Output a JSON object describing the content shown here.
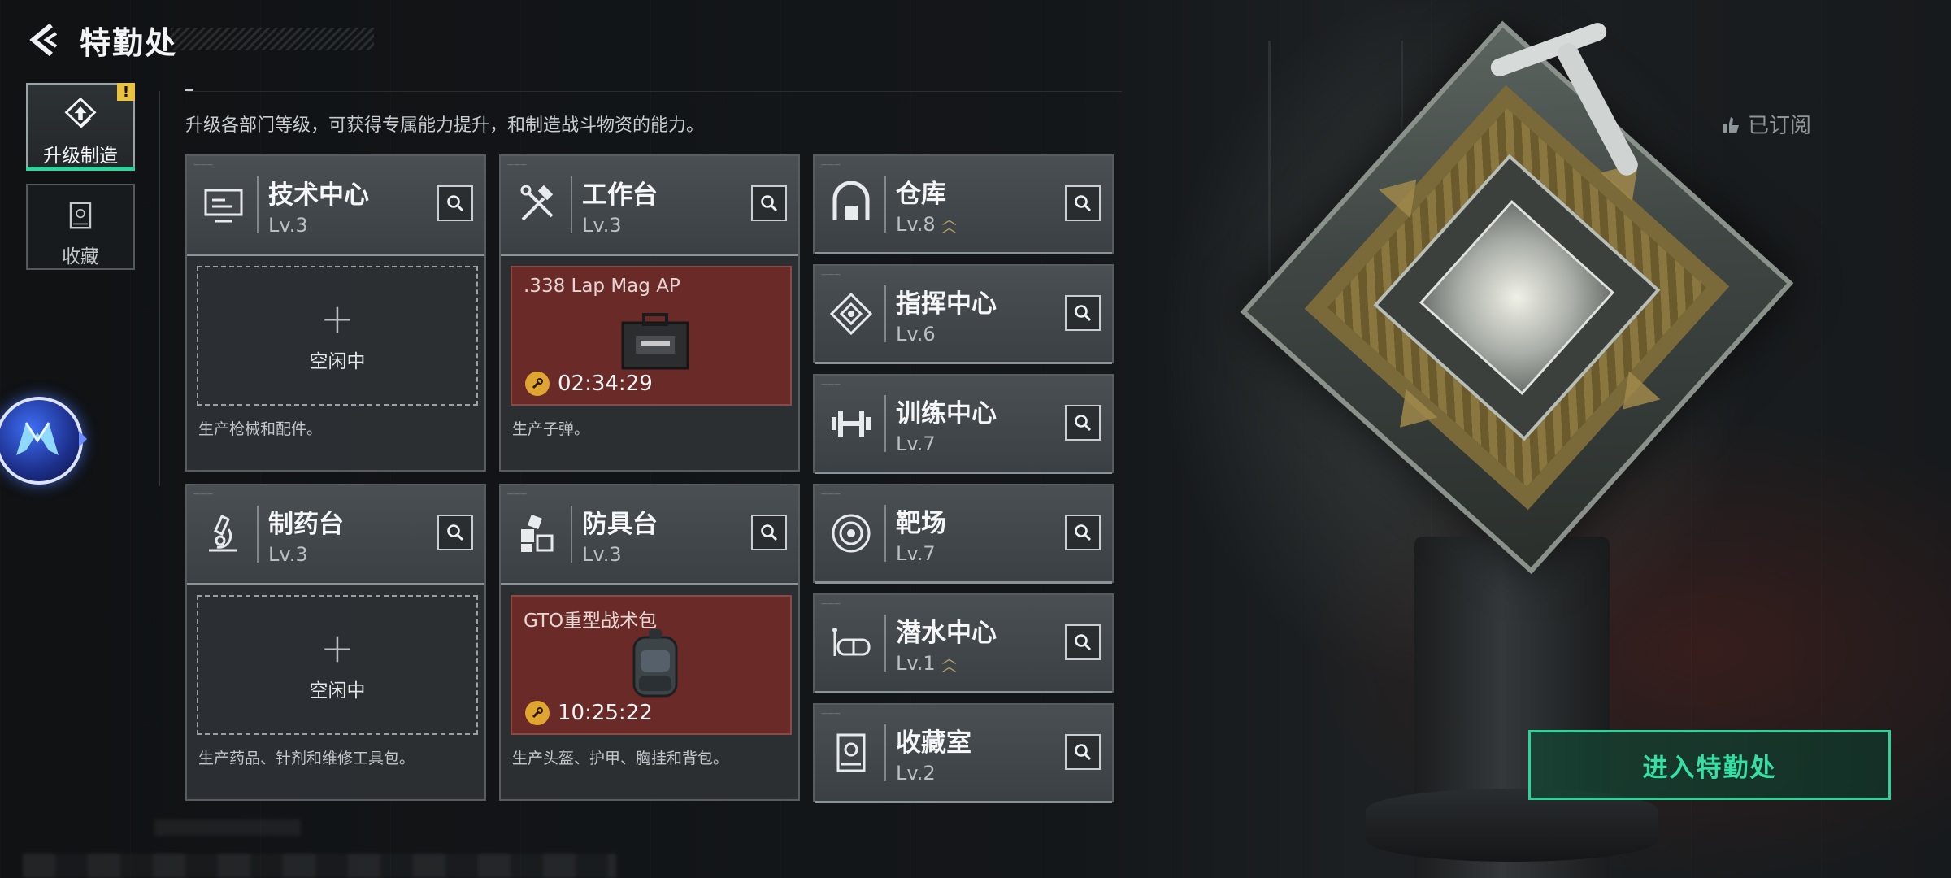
{
  "header": {
    "title": "特勤处"
  },
  "nav": [
    {
      "label": "升级制造",
      "active": true,
      "alert": "!"
    },
    {
      "label": "收藏",
      "active": false
    }
  ],
  "description": "升级各部门等级，可获得专属能力提升，和制造战斗物资的能力。",
  "subscribed_label": "已订阅",
  "enter_button": "进入特勤处",
  "departments": {
    "tech_center": {
      "name": "技术中心",
      "level": "Lv.3",
      "slot": {
        "status": "idle",
        "plus": "+",
        "text": "空闲中"
      },
      "caption": "生产枪械和配件。"
    },
    "workbench": {
      "name": "工作台",
      "level": "Lv.3",
      "slot": {
        "status": "producing",
        "item": ".338 Lap Mag AP",
        "timer": "02:34:29"
      },
      "caption": "生产子弹。"
    },
    "pharmacy": {
      "name": "制药台",
      "level": "Lv.3",
      "slot": {
        "status": "idle",
        "plus": "+",
        "text": "空闲中"
      },
      "caption": "生产药品、针剂和维修工具包。"
    },
    "armor_bench": {
      "name": "防具台",
      "level": "Lv.3",
      "slot": {
        "status": "producing",
        "item": "GTO重型战术包",
        "timer": "10:25:22"
      },
      "caption": "生产头盔、护甲、胸挂和背包。"
    },
    "warehouse": {
      "name": "仓库",
      "level": "Lv.8",
      "upgradable": true
    },
    "command_center": {
      "name": "指挥中心",
      "level": "Lv.6"
    },
    "training_center": {
      "name": "训练中心",
      "level": "Lv.7"
    },
    "shooting_range": {
      "name": "靶场",
      "level": "Lv.7"
    },
    "diving_center": {
      "name": "潜水中心",
      "level": "Lv.1",
      "upgradable": true
    },
    "collection_room": {
      "name": "收藏室",
      "level": "Lv.2"
    }
  },
  "icons": {
    "back": "chevron-left-icon",
    "upgrade": "upgrade-arrow-icon",
    "collection": "trophy-case-icon",
    "search": "magnifier-icon",
    "timer": "wrench-clock-icon"
  },
  "colors": {
    "accent": "#2fd29a",
    "producing_slot": "#6a2a28",
    "timer": "#e0a431",
    "alert": "#e8c240",
    "upgrade_chevron": "#b9a160"
  }
}
